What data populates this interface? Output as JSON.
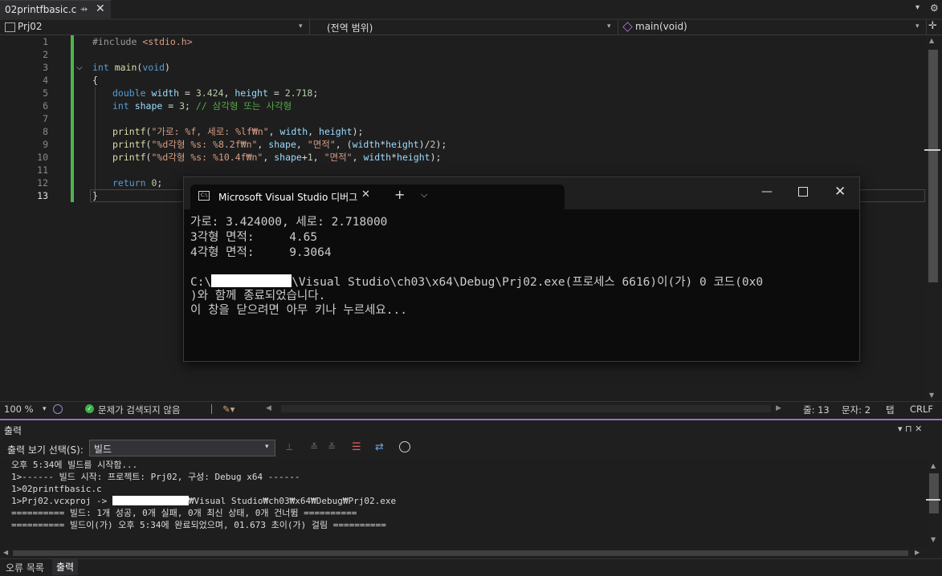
{
  "tab": {
    "filename": "02printfbasic.c",
    "pin": "⇸",
    "close": "✕"
  },
  "tabstrip": {
    "dropdown": "▾",
    "settings": "⚙"
  },
  "navbar": {
    "project": "Prj02",
    "scope": "(전역 범위)",
    "function": "main(void)",
    "dropdown": "▾",
    "split": "✛"
  },
  "editor": {
    "line_numbers": [
      "1",
      "2",
      "3",
      "4",
      "5",
      "6",
      "7",
      "8",
      "9",
      "10",
      "11",
      "12",
      "13"
    ],
    "current_line": "13"
  },
  "code": {
    "l1_pp": "#include ",
    "l1_hdr": "<stdio.h>",
    "l3_kw": "int",
    "l3_fn": " main",
    "l3_p1": "(",
    "l3_kw2": "void",
    "l3_p2": ")",
    "l4": "{",
    "l5_kw": "double",
    "l5_v1": " width",
    "l5_a": " = ",
    "l5_n1": "3.424",
    "l5_b": ", ",
    "l5_v2": "height",
    "l5_c": " = ",
    "l5_n2": "2.718",
    "l5_d": ";",
    "l6_kw": "int",
    "l6_v": " shape",
    "l6_a": " = ",
    "l6_n": "3",
    "l6_b": "; ",
    "l6_cmt": "// 삼각형 또는 사각형",
    "l8_fn": "printf",
    "l8_a": "(",
    "l8_s": "\"가로: %f, 세로: %lf₩n\"",
    "l8_b": ", ",
    "l8_v1": "width",
    "l8_c": ", ",
    "l8_v2": "height",
    "l8_d": ");",
    "l9_fn": "printf",
    "l9_a": "(",
    "l9_s": "\"%d각형 %s: %8.2f₩n\"",
    "l9_b": ", ",
    "l9_v1": "shape",
    "l9_c": ", ",
    "l9_s2": "\"면적\"",
    "l9_d": ", (",
    "l9_v2": "width",
    "l9_e": "*",
    "l9_v3": "height",
    "l9_f": ")/",
    "l9_n": "2",
    "l9_g": ");",
    "l10_fn": "printf",
    "l10_a": "(",
    "l10_s": "\"%d각형 %s: %10.4f₩n\"",
    "l10_b": ", ",
    "l10_v1": "shape",
    "l10_c": "+",
    "l10_n": "1",
    "l10_d": ", ",
    "l10_s2": "\"면적\"",
    "l10_e": ", ",
    "l10_v2": "width",
    "l10_f": "*",
    "l10_v3": "height",
    "l10_g": ");",
    "l12_kw": "return",
    "l12_a": " ",
    "l12_n": "0",
    "l12_b": ";",
    "l13": "}"
  },
  "console": {
    "tab_title": "Microsoft Visual Studio 디버그",
    "tab_close": "✕",
    "new_tab": "+",
    "tab_dropdown": "⌵",
    "minimize": "—",
    "close": "✕",
    "icon": "C:\\",
    "lines": [
      "가로: 3.424000, 세로: 2.718000",
      "3각형 면적:     4.65",
      "4각형 면적:     9.3064",
      "",
      "C:\\",
      ")와 함께 종료되었습니다.",
      "이 창을 닫으려면 아무 키나 누르세요..."
    ],
    "path_after_redact": "\\Visual Studio\\ch03\\x64\\Debug\\Prj02.exe(프로세스 6616)이(가) 0 코드(0x0"
  },
  "status": {
    "zoom": "100 %",
    "zoom_dd": "▾",
    "issues": "문제가 검색되지 않음",
    "line": "줄: 13",
    "col": "문자: 2",
    "tab": "탭",
    "eol": "CRLF"
  },
  "output": {
    "title": "출력",
    "show_from_label": "출력 보기 선택(S):",
    "show_from_value": "빌드",
    "title_controls": "▾  ⊓  ✕",
    "lines": [
      "오후 5:34에 빌드를 시작함...",
      "1>------ 빌드 시작: 프로젝트: Prj02, 구성: Debug x64 ------",
      "1>02printfbasic.c",
      "1>Prj02.vcxproj -> ",
      "========== 빌드: 1개 성공, 0개 실패, 0개 최신 상태, 0개 건너뜀 ==========",
      "========== 빌드이(가) 오후 5:34에 완료되었으며, 01.673 초이(가) 걸림 =========="
    ],
    "path_after_redact": "₩Visual Studio₩ch03₩x64₩Debug₩Prj02.exe"
  },
  "bottom_tabs": {
    "errors": "오류 목록",
    "output": "출력"
  },
  "colors": {
    "accent": "#9a6fc7",
    "changebar": "#4fb34f",
    "keyword": "#569cd6",
    "string": "#d69d85",
    "comment": "#57a64a"
  }
}
